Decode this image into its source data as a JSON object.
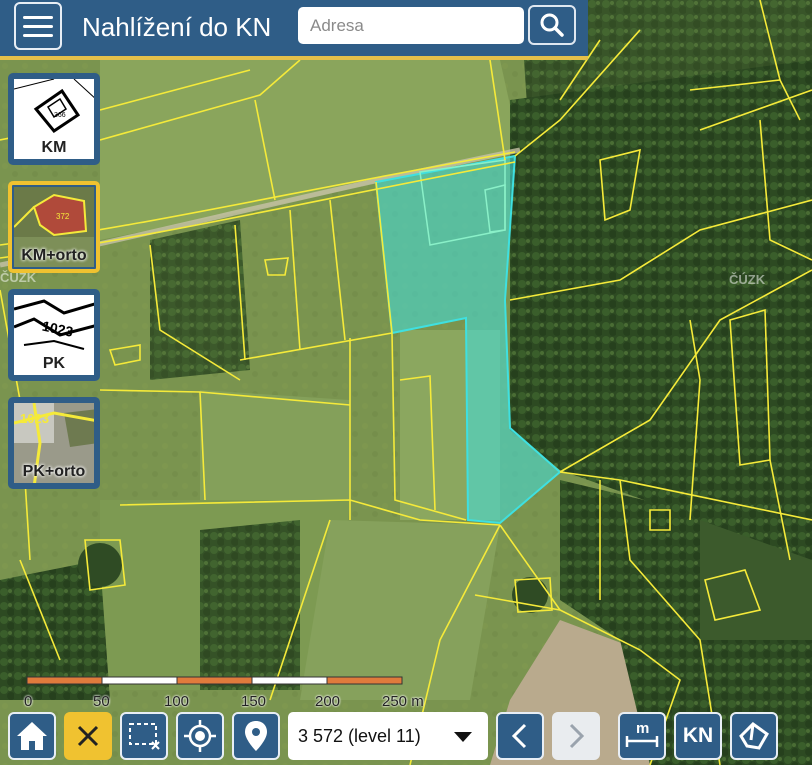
{
  "header": {
    "title": "Nahlížení do KN",
    "search_placeholder": "Adresa"
  },
  "layers": [
    {
      "label": "KM",
      "active": false,
      "thumb_text": "366"
    },
    {
      "label": "KM+orto",
      "active": true,
      "thumb_text": "372"
    },
    {
      "label": "PK",
      "active": false,
      "thumb_text": "1023"
    },
    {
      "label": "PK+orto",
      "active": false,
      "thumb_text": "1023"
    }
  ],
  "map": {
    "watermark": "ČÚZK",
    "scalebar_labels": [
      "0",
      "50",
      "100",
      "150",
      "200",
      "250 m"
    ]
  },
  "toolbar": {
    "scale_value": "3 572 (level 11)",
    "kn_label": "KN",
    "measure_label": "m"
  },
  "colors": {
    "brand_blue": "#2f5d87",
    "accent_yellow": "#f0c230",
    "parcel_line": "#f5ea3a",
    "selection_fill": "#3fe0e0"
  }
}
